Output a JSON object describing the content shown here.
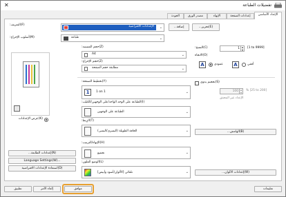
{
  "window": {
    "title": "تفضيلات الطباعة",
    "close_glyph": "✕"
  },
  "tabs": [
    "الإعداد الأساسي",
    "إعدادات الصفحة",
    "الإنهاء",
    "مصدر الورق",
    "الجودة"
  ],
  "profile": {
    "label": "(F)التعريف:",
    "value": "الإعدادات الافتراضية",
    "add_label": "إضافة...",
    "edit_label": "(E)تحرير...",
    "output_label": "(M)أسلوب الإخراج:",
    "output_value": "طباعة"
  },
  "original_size": {
    "label": "(Z)حجم المستند:",
    "value": "A4"
  },
  "output_size": {
    "label": "(Z)حجم الإخراج:",
    "value": "مطابقة حجم الصفحة"
  },
  "copies": {
    "label": "(C)النسخ:",
    "value": "1",
    "range": "[1 to 9999]"
  },
  "orientation": {
    "label": "(O)الاتجاه",
    "portrait": "عمودي",
    "landscape": "أفقي",
    "portrait_icon": "A",
    "landscape_icon": "A",
    "selected": "portrait"
  },
  "page_layout": {
    "label": "(Y)تخطيط الصفحة:",
    "value": "1 on 1",
    "icon": "1"
  },
  "manual_scaling": {
    "label": "(S)تحجيم يدوي",
    "value": "100",
    "range": "% [25 to 200]",
    "unit_note": "الإعداد غير المحقق"
  },
  "duplex": {
    "label": "(I)الطباعة على الوجه الواحد/على الوجهين/الكتيّب:",
    "value": "الطباعة على الوجهين"
  },
  "binding": {
    "label": "(T)الرِبط:",
    "value": "الحافة الطويلة (اليسرى/اليمنى)"
  },
  "binding_location_button": "(B)الهامش...",
  "finishing": {
    "label": "(H)الإنهاء/الترتيب:",
    "value": "تجميع"
  },
  "color_mode": {
    "label": "(L)الوضع الملون:",
    "value": "تلقائي [الألوان/أسود وأبيض]"
  },
  "color_settings_button": "(W)إعدادات الألوان...",
  "preview": {
    "settings_toggle_label": "(K)عرض الإعدادات",
    "printer_settings_button": "(N)إعدادات الطابعة...",
    "language_button": "Language Settings(W)...",
    "restore_defaults_button": "(D)استعادة الإعدادات الافتراضية"
  },
  "footer": {
    "ok": "موافق",
    "cancel": "إلغاء الأمر",
    "apply": "تطبيق",
    "help": "تعليمات"
  },
  "colors": {
    "accent": "#e8a030",
    "header_bg": "#1c2e8e",
    "selection": "#1f5fbf"
  },
  "icons": [
    "printer-icon",
    "close-icon",
    "copies-icon",
    "layout-icon",
    "duplex-icon",
    "binding-icon",
    "finishing-icon",
    "color-mode-icon",
    "page-preview-icon"
  ]
}
